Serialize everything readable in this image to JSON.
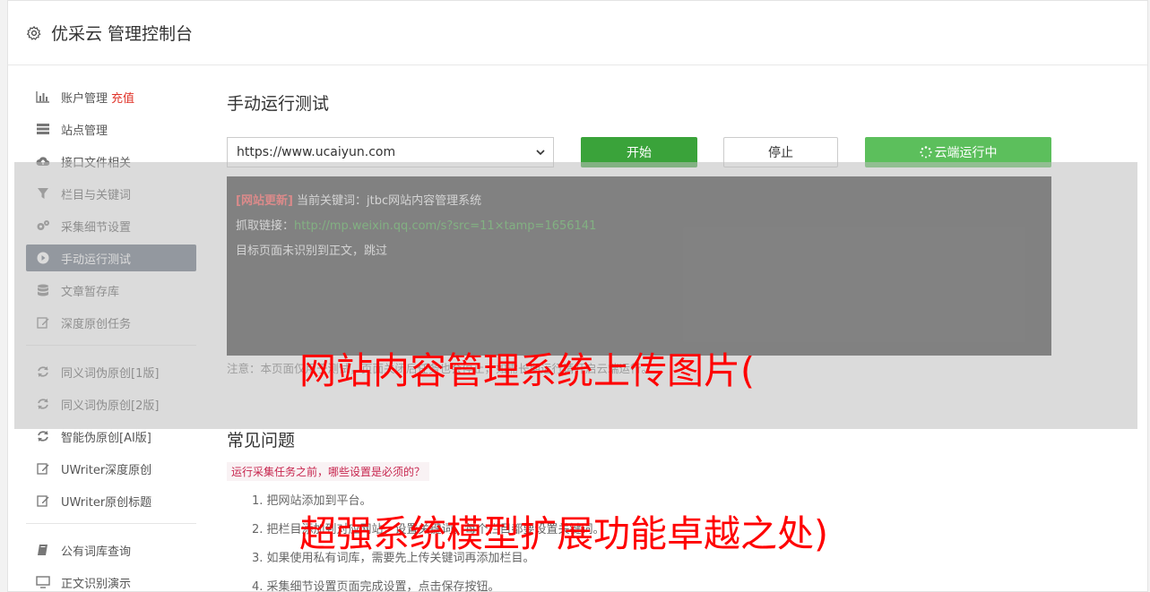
{
  "header": {
    "title": "优采云 管理控制台"
  },
  "sidebar": {
    "items": [
      {
        "label": "账户管理",
        "accent": "充值",
        "icon": "bar-chart-icon"
      },
      {
        "label": "站点管理",
        "icon": "server-icon"
      },
      {
        "label": "接口文件相关",
        "icon": "cloud-upload-icon"
      },
      {
        "label": "栏目与关键词",
        "icon": "filter-icon"
      },
      {
        "label": "采集细节设置",
        "icon": "gears-icon"
      },
      {
        "label": "手动运行测试",
        "icon": "play-icon",
        "active": true
      },
      {
        "label": "文章暂存库",
        "icon": "database-icon"
      },
      {
        "label": "深度原创任务",
        "icon": "edit-icon"
      },
      {
        "label": "同义词伪原创[1版]",
        "icon": "refresh-icon"
      },
      {
        "label": "同义词伪原创[2版]",
        "icon": "refresh-icon"
      },
      {
        "label": "智能伪原创[AI版]",
        "icon": "refresh-icon"
      },
      {
        "label": "UWriter深度原创",
        "icon": "edit-icon"
      },
      {
        "label": "UWriter原创标题",
        "icon": "edit-icon"
      },
      {
        "label": "公有词库查询",
        "icon": "book-icon"
      },
      {
        "label": "正文识别演示",
        "icon": "monitor-icon"
      }
    ]
  },
  "main": {
    "title": "手动运行测试",
    "url_value": "https://www.ucaiyun.com",
    "start_label": "开始",
    "stop_label": "停止",
    "cloud_label": "云端运行中",
    "console": {
      "tag": "[网站更新]",
      "line1_rest": " 当前关键词：jtbc网站内容管理系统",
      "line2_label": "抓取链接：",
      "line2_link": "http://mp.weixin.qq.com/s?src=11×tamp=1656141",
      "line3": "目标页面未识别到正文，跳过"
    },
    "note": "注意：本页面仅用于测试，页面关闭后任务也会停止，如需长期运行请开启云端运行。"
  },
  "faq": {
    "title": "常见问题",
    "question": "运行采集任务之前，哪些设置是必须的？",
    "answers": [
      "1. 把网站添加到平台。",
      "2. 把栏目添加到对应网站，设置关键词，每个栏目都要设置关键词。",
      "3. 如果使用私有词库，需要先上传关键词再添加栏目。",
      "4. 采集细节设置页面完成设置，点击保存按钮。"
    ]
  },
  "watermarks": {
    "line1": "网站内容管理系统上传图片(",
    "line2": "超强系统模型扩展功能卓越之处)"
  },
  "colors": {
    "active_nav": "#5f6a7a",
    "start_btn": "#3aa33a",
    "cloud_btn": "#5cbf5c",
    "console_bg": "#393939",
    "watermark": "#ff0000"
  }
}
